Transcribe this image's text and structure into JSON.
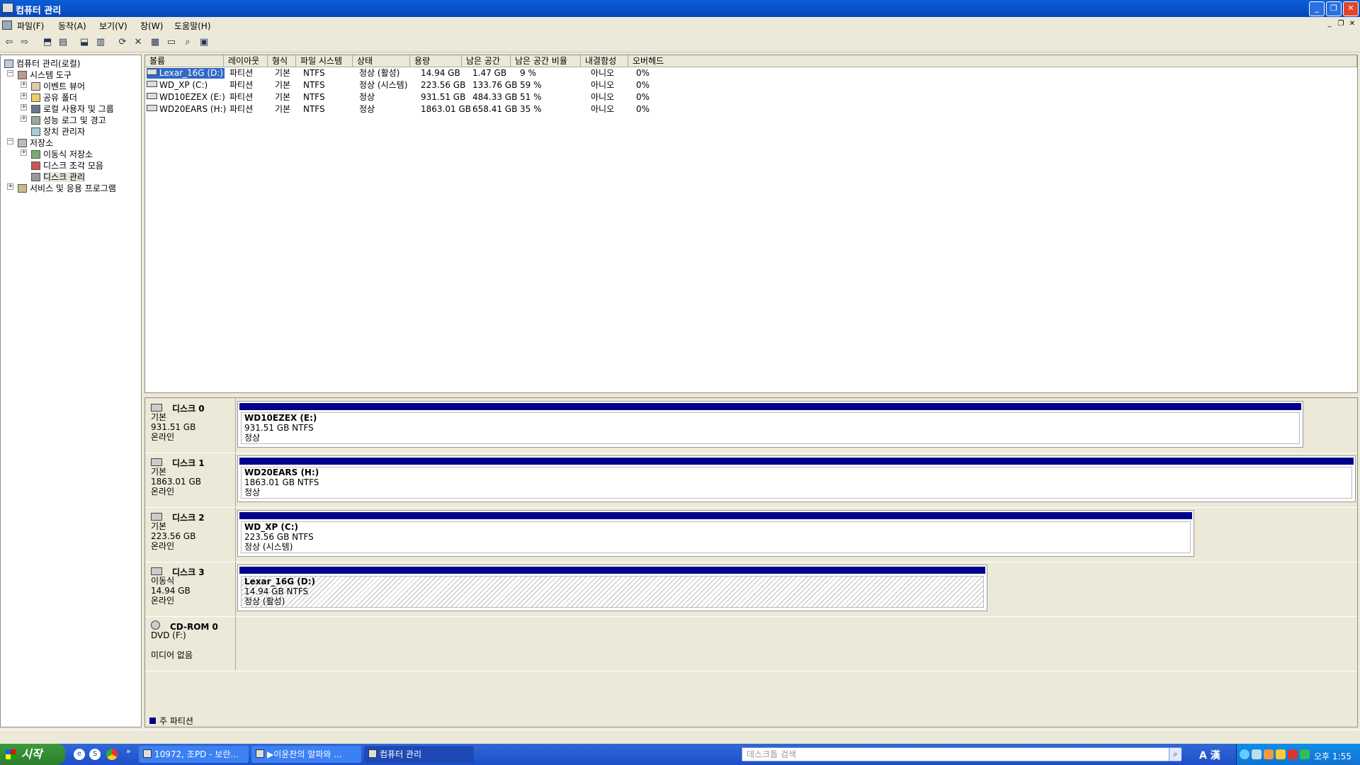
{
  "window": {
    "title": "컴퓨터 관리"
  },
  "menu": [
    "파일(F)",
    "동작(A)",
    "보기(V)",
    "창(W)",
    "도움말(H)"
  ],
  "tree": {
    "root": "컴퓨터 관리(로컬)",
    "system_tools": "시스템 도구",
    "event_viewer": "이벤트 뷰어",
    "shared_folders": "공유 폴더",
    "local_users": "로컬 사용자 및 그룹",
    "perf_logs": "성능 로그 및 경고",
    "device_manager": "장치 관리자",
    "storage": "저장소",
    "removable_storage": "이동식 저장소",
    "defrag": "디스크 조각 모음",
    "disk_management": "디스크 관리",
    "services_apps": "서비스 및 응용 프로그램"
  },
  "volume_list": {
    "headers": [
      "볼륨",
      "레이아웃",
      "형식",
      "파일 시스템",
      "상태",
      "용량",
      "남은 공간",
      "남은 공간 비율",
      "내결함성",
      "오버헤드"
    ],
    "rows": [
      [
        "Lexar_16G (D:)",
        "파티션",
        "기본",
        "NTFS",
        "정상 (활성)",
        "14.94 GB",
        "1.47 GB",
        "9 %",
        "아니오",
        "0%"
      ],
      [
        "WD_XP (C:)",
        "파티션",
        "기본",
        "NTFS",
        "정상 (시스템)",
        "223.56 GB",
        "133.76 GB",
        "59 %",
        "아니오",
        "0%"
      ],
      [
        "WD10EZEX (E:)",
        "파티션",
        "기본",
        "NTFS",
        "정상",
        "931.51 GB",
        "484.33 GB",
        "51 %",
        "아니오",
        "0%"
      ],
      [
        "WD20EARS (H:)",
        "파티션",
        "기본",
        "NTFS",
        "정상",
        "1863.01 GB",
        "658.41 GB",
        "35 %",
        "아니오",
        "0%"
      ]
    ]
  },
  "disks": [
    {
      "name": "디스크 0",
      "type": "기본",
      "size": "931.51 GB",
      "status": "온라인",
      "part_title": "WD10EZEX  (E:)",
      "part_size": "931.51 GB NTFS",
      "part_status": "정상"
    },
    {
      "name": "디스크 1",
      "type": "기본",
      "size": "1863.01 GB",
      "status": "온라인",
      "part_title": "WD20EARS  (H:)",
      "part_size": "1863.01 GB NTFS",
      "part_status": "정상"
    },
    {
      "name": "디스크 2",
      "type": "기본",
      "size": "223.56 GB",
      "status": "온라인",
      "part_title": "WD_XP  (C:)",
      "part_size": "223.56 GB NTFS",
      "part_status": "정상 (시스템)"
    },
    {
      "name": "디스크 3",
      "type": "이동식",
      "size": "14.94 GB",
      "status": "온라인",
      "part_title": "Lexar_16G  (D:)",
      "part_size": "14.94 GB NTFS",
      "part_status": "정상 (활성)"
    }
  ],
  "cdrom": {
    "name": "CD-ROM 0",
    "drive": "DVD (F:)",
    "media": "미디어 없음"
  },
  "legend": {
    "primary": "주 파티션",
    "primary_color": "#00008b"
  },
  "taskbar": {
    "start": "시작",
    "tasks": [
      "10972, 조PD - 보란...",
      "▶이윤찬의 알파와 ...",
      "컴퓨터 관리"
    ],
    "search_placeholder": "데스크톱 검색",
    "ime": "A 漢",
    "clock": "오후 1:55"
  }
}
